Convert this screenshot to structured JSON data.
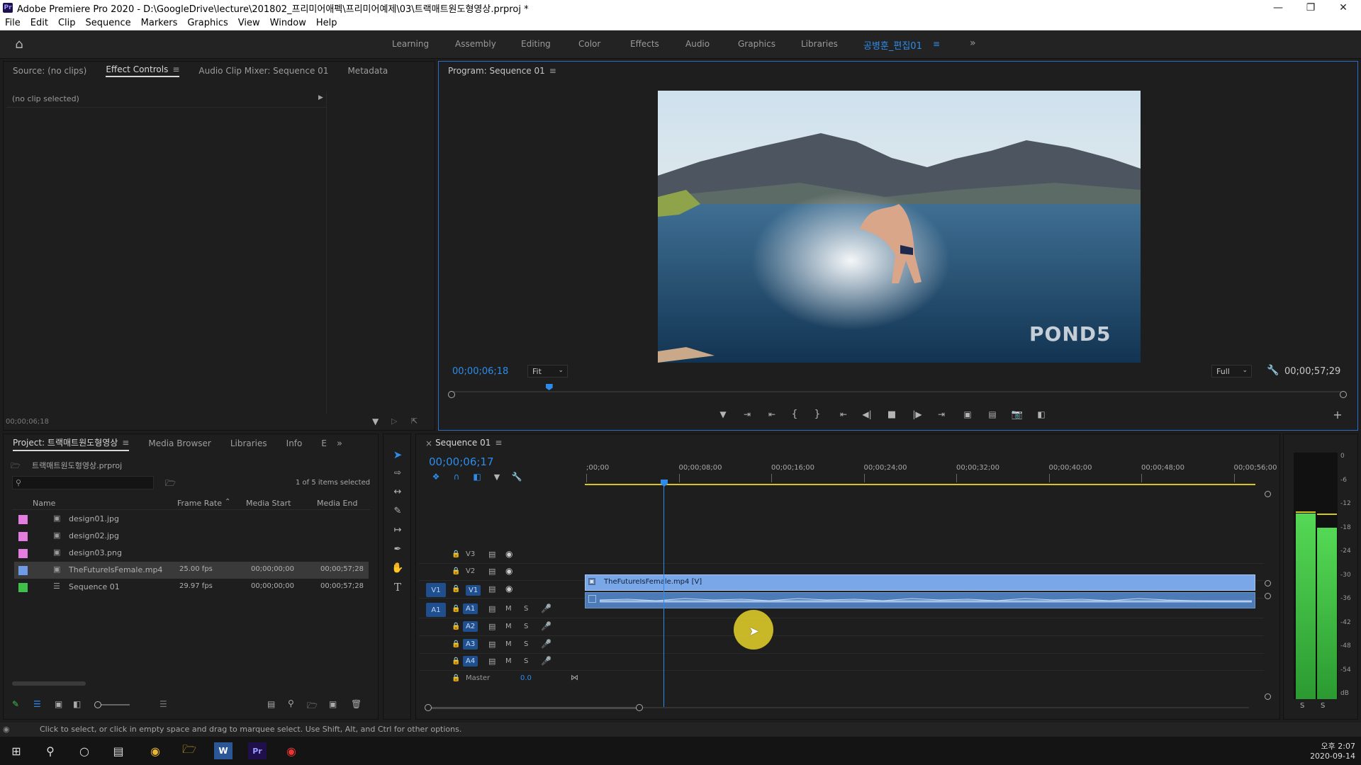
{
  "window": {
    "title": "Adobe Premiere Pro 2020 - D:\\GoogleDrive\\lecture\\201802_프리미어애펙\\프리미어예제\\03\\트랙매트원도형영상.prproj *",
    "app_icon": "Pr"
  },
  "menu": [
    "File",
    "Edit",
    "Clip",
    "Sequence",
    "Markers",
    "Graphics",
    "View",
    "Window",
    "Help"
  ],
  "workspaces": [
    "Learning",
    "Assembly",
    "Editing",
    "Color",
    "Effects",
    "Audio",
    "Graphics",
    "Libraries"
  ],
  "active_workspace": "공병훈_편집01",
  "source_panel": {
    "tabs": [
      "Source: (no clips)",
      "Effect Controls",
      "Audio Clip Mixer: Sequence 01",
      "Metadata"
    ],
    "active_tab": "Effect Controls",
    "no_clip": "(no clip selected)",
    "timecode": "00;00;06;18"
  },
  "program_monitor": {
    "title": "Program: Sequence 01",
    "timecode": "00;00;06;18",
    "fit": "Fit",
    "quality": "Full",
    "duration": "00;00;57;29",
    "watermark": "POND5",
    "playhead_fraction": 0.109
  },
  "project_panel": {
    "tabs": [
      "Project: 트랙매트원도형영상",
      "Media Browser",
      "Libraries",
      "Info",
      "E"
    ],
    "file": "트랙매트원도형영상.prproj",
    "selection_info": "1 of 5 items selected",
    "columns": [
      "Name",
      "Frame Rate",
      "Media Start",
      "Media End"
    ],
    "items": [
      {
        "name": "design01.jpg",
        "fps": "",
        "start": "",
        "end": "",
        "color": "#e37de0"
      },
      {
        "name": "design02.jpg",
        "fps": "",
        "start": "",
        "end": "",
        "color": "#e37de0"
      },
      {
        "name": "design03.png",
        "fps": "",
        "start": "",
        "end": "",
        "color": "#e37de0"
      },
      {
        "name": "TheFutureIsFemale.mp4",
        "fps": "25.00 fps",
        "start": "00;00;00;00",
        "end": "00;00;57;28",
        "color": "#6f9be6"
      },
      {
        "name": "Sequence 01",
        "fps": "29.97 fps",
        "start": "00;00;00;00",
        "end": "00;00;57;28",
        "color": "#3fc04a"
      }
    ]
  },
  "timeline": {
    "tab": "Sequence 01",
    "timecode": "00;00;06;17",
    "ruler": [
      ";00;00",
      "00;00;08;00",
      "00;00;16;00",
      "00;00;24;00",
      "00;00;32;00",
      "00;00;40;00",
      "00;00;48;00",
      "00;00;56;00"
    ],
    "video_tracks": [
      "V3",
      "V2",
      "V1"
    ],
    "audio_tracks": [
      "A1",
      "A2",
      "A3",
      "A4"
    ],
    "master_label": "Master",
    "master_value": "0.0",
    "video_clip": "TheFutureIsFemale.mp4 [V]",
    "mute": "M",
    "solo": "S"
  },
  "meter": {
    "scale": [
      "0",
      "-6",
      "-12",
      "-18",
      "-24",
      "-30",
      "-36",
      "-42",
      "-48",
      "-54",
      "dB"
    ],
    "solo_left": "S",
    "solo_right": "S"
  },
  "status_bar": "Click to select, or click in empty space and drag to marquee select. Use Shift, Alt, and Ctrl for other options.",
  "taskbar": {
    "time": "오후 2:07",
    "date": "2020-09-14"
  },
  "colors": {
    "accent": "#2d8ceb",
    "clip_video": "#7aa7e8",
    "clip_audio": "#4d7bb8",
    "meter_green": "#35c23a"
  }
}
